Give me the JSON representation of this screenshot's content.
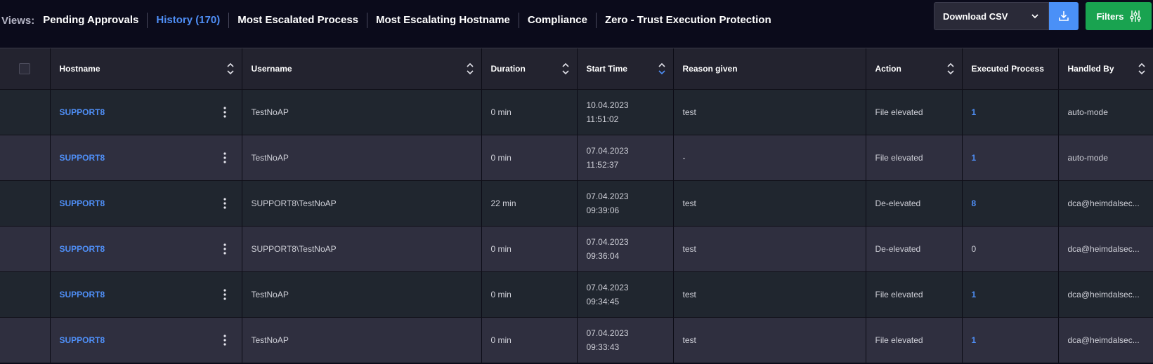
{
  "views": {
    "label": "Views:",
    "tabs": [
      {
        "label": "Pending Approvals",
        "active": false
      },
      {
        "label": "History (170)",
        "active": true
      },
      {
        "label": "Most Escalated Process",
        "active": false
      },
      {
        "label": "Most Escalating Hostname",
        "active": false
      },
      {
        "label": "Compliance",
        "active": false
      },
      {
        "label": "Zero - Trust Execution Protection",
        "active": false
      }
    ]
  },
  "toolbar": {
    "download_label": "Download CSV",
    "filters_label": "Filters",
    "download_icon": "download-icon",
    "filters_icon": "sliders-icon"
  },
  "colors": {
    "accent_blue": "#4f8ff7",
    "filters_green": "#19a350",
    "download_blue": "#4a90f7"
  },
  "table": {
    "columns": [
      {
        "label": "Hostname",
        "sortable": true
      },
      {
        "label": "Username",
        "sortable": true
      },
      {
        "label": "Duration",
        "sortable": true
      },
      {
        "label": "Start Time",
        "sortable": true,
        "sorted": "desc"
      },
      {
        "label": "Reason given",
        "sortable": false
      },
      {
        "label": "Action",
        "sortable": true
      },
      {
        "label": "Executed Process",
        "sortable": false
      },
      {
        "label": "Handled By",
        "sortable": true
      }
    ],
    "rows": [
      {
        "hostname": "SUPPORT8",
        "username": "TestNoAP",
        "duration": "0 min",
        "start_date": "10.04.2023",
        "start_time": "11:51:02",
        "reason": "test",
        "action": "File elevated",
        "executed": "1",
        "executed_link": true,
        "handled_by": "auto-mode"
      },
      {
        "hostname": "SUPPORT8",
        "username": "TestNoAP",
        "duration": "0 min",
        "start_date": "07.04.2023",
        "start_time": "11:52:37",
        "reason": "-",
        "action": "File elevated",
        "executed": "1",
        "executed_link": true,
        "handled_by": "auto-mode"
      },
      {
        "hostname": "SUPPORT8",
        "username": "SUPPORT8\\TestNoAP",
        "duration": "22 min",
        "start_date": "07.04.2023",
        "start_time": "09:39:06",
        "reason": "test",
        "action": "De-elevated",
        "executed": "8",
        "executed_link": true,
        "handled_by": "dca@heimdalsec..."
      },
      {
        "hostname": "SUPPORT8",
        "username": "SUPPORT8\\TestNoAP",
        "duration": "0 min",
        "start_date": "07.04.2023",
        "start_time": "09:36:04",
        "reason": "test",
        "action": "De-elevated",
        "executed": "0",
        "executed_link": false,
        "handled_by": "dca@heimdalsec..."
      },
      {
        "hostname": "SUPPORT8",
        "username": "TestNoAP",
        "duration": "0 min",
        "start_date": "07.04.2023",
        "start_time": "09:34:45",
        "reason": "test",
        "action": "File elevated",
        "executed": "1",
        "executed_link": true,
        "handled_by": "dca@heimdalsec..."
      },
      {
        "hostname": "SUPPORT8",
        "username": "TestNoAP",
        "duration": "0 min",
        "start_date": "07.04.2023",
        "start_time": "09:33:43",
        "reason": "test",
        "action": "File elevated",
        "executed": "1",
        "executed_link": true,
        "handled_by": "dca@heimdalsec..."
      }
    ]
  }
}
